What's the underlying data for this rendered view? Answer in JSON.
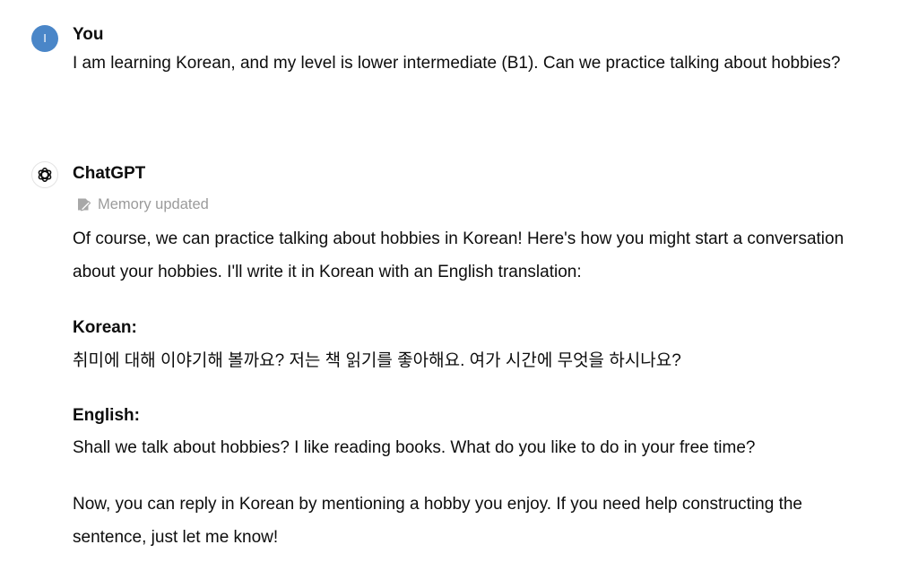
{
  "conversation": {
    "user": {
      "avatar_initial": "I",
      "name": "You",
      "message": "I am learning Korean, and my level is lower intermediate (B1). Can we practice talking about hobbies?"
    },
    "assistant": {
      "avatar_icon": "openai-logo-icon",
      "name": "ChatGPT",
      "memory_status": "Memory updated",
      "intro": "Of course, we can practice talking about hobbies in Korean! Here's how you might start a conversation about your hobbies. I'll write it in Korean with an English translation:",
      "korean_heading": "Korean:",
      "korean_text": "취미에 대해 이야기해 볼까요? 저는 책 읽기를 좋아해요. 여가 시간에 무엇을 하시나요?",
      "english_heading": "English:",
      "english_text": "Shall we talk about hobbies? I like reading books. What do you like to do in your free time?",
      "closing": "Now, you can reply in Korean by mentioning a hobby you enjoy. If you need help constructing the sentence, just let me know!"
    }
  },
  "colors": {
    "user_avatar": "#4a86c8",
    "text": "#0d0d0d",
    "muted": "#9b9b9b"
  }
}
